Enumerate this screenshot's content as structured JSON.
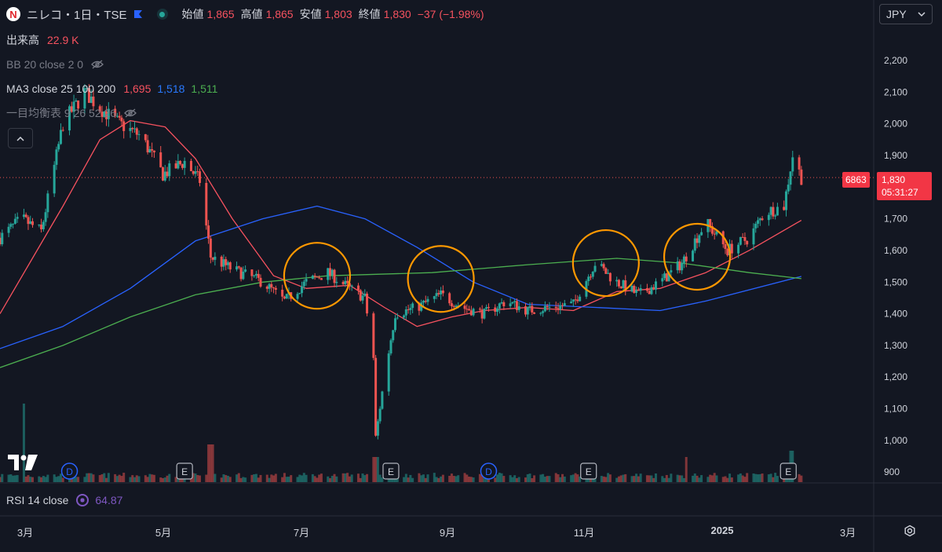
{
  "header": {
    "symbol_title": "ニレコ・1日・TSE",
    "logo_letter": "N",
    "open_label": "始値",
    "open": "1,865",
    "high_label": "高値",
    "high": "1,865",
    "low_label": "安値",
    "low": "1,803",
    "close_label": "終値",
    "close": "1,830",
    "change": "−37 (−1.98%)"
  },
  "legend": {
    "volume_label": "出来高",
    "volume_value": "22.9 K",
    "bb_label": "BB 20 close 2 0",
    "ma_label": "MA3 close 25 100 200",
    "ma25_value": "1,695",
    "ma100_value": "1,518",
    "ma200_value": "1,511",
    "ichimoku_label": "一目均衡表 9 26 52 26",
    "collapse_icon": "chevron-up-icon"
  },
  "currency": {
    "label": "JPY",
    "icon": "chevron-down-icon"
  },
  "price_labels": {
    "symbol_code": "6863",
    "last_price": "1,830",
    "countdown": "05:31:27"
  },
  "rsi": {
    "label": "RSI 14 close",
    "value": "64.87"
  },
  "colors": {
    "background": "#131722",
    "grid": "#1e222d",
    "up": "#26a69a",
    "down": "#ef5350",
    "ma25": "#f7525f",
    "ma100": "#2962ff",
    "ma200": "#4caf50",
    "highlight_circle": "#ff9800",
    "rsi": "#7e57c2"
  },
  "chart_data": {
    "type": "candlestick",
    "y_axis": {
      "ticks": [
        "900",
        "1,000",
        "1,100",
        "1,200",
        "1,300",
        "1,400",
        "1,500",
        "1,600",
        "1,700",
        "1,800",
        "1,900",
        "2,000",
        "2,100",
        "2,200"
      ],
      "ylim": [
        870,
        2260
      ]
    },
    "x_axis": {
      "labels": [
        "3月",
        "5月",
        "7月",
        "9月",
        "11月",
        "2025",
        "3月"
      ],
      "range": [
        "2024-02-15",
        "2025-03-15"
      ]
    },
    "price_series": [
      {
        "date": "2024-02-15",
        "close": 1640
      },
      {
        "date": "2024-02-25",
        "close": 1700
      },
      {
        "date": "2024-03-05",
        "close": 1660
      },
      {
        "date": "2024-03-15",
        "close": 2000
      },
      {
        "date": "2024-03-25",
        "close": 2100
      },
      {
        "date": "2024-04-01",
        "close": 2050
      },
      {
        "date": "2024-04-10",
        "close": 2000
      },
      {
        "date": "2024-04-20",
        "close": 1960
      },
      {
        "date": "2024-04-30",
        "close": 1840
      },
      {
        "date": "2024-05-10",
        "close": 1880
      },
      {
        "date": "2024-05-17",
        "close": 1820
      },
      {
        "date": "2024-05-22",
        "close": 1580
      },
      {
        "date": "2024-06-01",
        "close": 1540
      },
      {
        "date": "2024-06-15",
        "close": 1500
      },
      {
        "date": "2024-06-25",
        "close": 1440
      },
      {
        "date": "2024-07-05",
        "close": 1500
      },
      {
        "date": "2024-07-15",
        "close": 1530
      },
      {
        "date": "2024-07-25",
        "close": 1480
      },
      {
        "date": "2024-08-01",
        "close": 1450
      },
      {
        "date": "2024-08-05",
        "close": 1260
      },
      {
        "date": "2024-08-06",
        "close": 1010
      },
      {
        "date": "2024-08-10",
        "close": 1200
      },
      {
        "date": "2024-08-15",
        "close": 1400
      },
      {
        "date": "2024-08-25",
        "close": 1420
      },
      {
        "date": "2024-09-05",
        "close": 1460
      },
      {
        "date": "2024-09-15",
        "close": 1420
      },
      {
        "date": "2024-09-25",
        "close": 1400
      },
      {
        "date": "2024-10-05",
        "close": 1440
      },
      {
        "date": "2024-10-15",
        "close": 1410
      },
      {
        "date": "2024-10-25",
        "close": 1420
      },
      {
        "date": "2024-11-05",
        "close": 1430
      },
      {
        "date": "2024-11-15",
        "close": 1560
      },
      {
        "date": "2024-11-25",
        "close": 1500
      },
      {
        "date": "2024-12-05",
        "close": 1460
      },
      {
        "date": "2024-12-15",
        "close": 1500
      },
      {
        "date": "2024-12-25",
        "close": 1560
      },
      {
        "date": "2025-01-05",
        "close": 1690
      },
      {
        "date": "2025-01-15",
        "close": 1600
      },
      {
        "date": "2025-01-25",
        "close": 1640
      },
      {
        "date": "2025-02-01",
        "close": 1720
      },
      {
        "date": "2025-02-10",
        "close": 1740
      },
      {
        "date": "2025-02-14",
        "close": 1900
      },
      {
        "date": "2025-02-18",
        "close": 1830
      }
    ],
    "ma25": [
      {
        "date": "2024-02-15",
        "value": 1400
      },
      {
        "date": "2024-03-15",
        "value": 1740
      },
      {
        "date": "2024-04-01",
        "value": 1950
      },
      {
        "date": "2024-04-15",
        "value": 2010
      },
      {
        "date": "2024-05-01",
        "value": 1990
      },
      {
        "date": "2024-05-15",
        "value": 1890
      },
      {
        "date": "2024-06-01",
        "value": 1700
      },
      {
        "date": "2024-06-20",
        "value": 1520
      },
      {
        "date": "2024-07-05",
        "value": 1480
      },
      {
        "date": "2024-07-25",
        "value": 1490
      },
      {
        "date": "2024-08-10",
        "value": 1420
      },
      {
        "date": "2024-08-25",
        "value": 1360
      },
      {
        "date": "2024-09-10",
        "value": 1390
      },
      {
        "date": "2024-09-25",
        "value": 1410
      },
      {
        "date": "2024-10-15",
        "value": 1420
      },
      {
        "date": "2024-11-05",
        "value": 1410
      },
      {
        "date": "2024-11-25",
        "value": 1470
      },
      {
        "date": "2024-12-15",
        "value": 1480
      },
      {
        "date": "2025-01-05",
        "value": 1530
      },
      {
        "date": "2025-01-25",
        "value": 1600
      },
      {
        "date": "2025-02-18",
        "value": 1695
      }
    ],
    "ma100": [
      {
        "date": "2024-02-15",
        "value": 1290
      },
      {
        "date": "2024-03-15",
        "value": 1360
      },
      {
        "date": "2024-04-15",
        "value": 1480
      },
      {
        "date": "2024-05-15",
        "value": 1630
      },
      {
        "date": "2024-06-15",
        "value": 1700
      },
      {
        "date": "2024-07-10",
        "value": 1740
      },
      {
        "date": "2024-08-01",
        "value": 1700
      },
      {
        "date": "2024-08-25",
        "value": 1610
      },
      {
        "date": "2024-09-20",
        "value": 1500
      },
      {
        "date": "2024-10-15",
        "value": 1430
      },
      {
        "date": "2024-11-15",
        "value": 1420
      },
      {
        "date": "2024-12-15",
        "value": 1410
      },
      {
        "date": "2025-01-05",
        "value": 1440
      },
      {
        "date": "2025-02-18",
        "value": 1518
      }
    ],
    "ma200": [
      {
        "date": "2024-02-15",
        "value": 1230
      },
      {
        "date": "2024-03-15",
        "value": 1300
      },
      {
        "date": "2024-04-15",
        "value": 1390
      },
      {
        "date": "2024-05-15",
        "value": 1460
      },
      {
        "date": "2024-06-15",
        "value": 1500
      },
      {
        "date": "2024-07-15",
        "value": 1520
      },
      {
        "date": "2024-09-01",
        "value": 1530
      },
      {
        "date": "2024-10-15",
        "value": 1555
      },
      {
        "date": "2024-11-25",
        "value": 1575
      },
      {
        "date": "2024-12-25",
        "value": 1560
      },
      {
        "date": "2025-01-25",
        "value": 1530
      },
      {
        "date": "2025-02-18",
        "value": 1511
      }
    ],
    "highlight_circles": [
      {
        "date": "2024-07-10",
        "price": 1520
      },
      {
        "date": "2024-09-05",
        "price": 1510
      },
      {
        "date": "2024-11-20",
        "price": 1560
      },
      {
        "date": "2025-01-01",
        "price": 1580
      }
    ],
    "events": [
      {
        "date": "2024-03-18",
        "label": "D",
        "kind": "dividend"
      },
      {
        "date": "2024-05-10",
        "label": "E",
        "kind": "earnings"
      },
      {
        "date": "2024-08-13",
        "label": "E",
        "kind": "earnings"
      },
      {
        "date": "2024-09-27",
        "label": "D",
        "kind": "dividend"
      },
      {
        "date": "2024-11-12",
        "label": "E",
        "kind": "earnings"
      },
      {
        "date": "2025-02-12",
        "label": "E",
        "kind": "earnings"
      }
    ],
    "volume_spikes": [
      {
        "date": "2024-02-25",
        "value": 5.0
      },
      {
        "date": "2024-05-22",
        "value": 2.4
      },
      {
        "date": "2024-08-06",
        "value": 1.6
      },
      {
        "date": "2024-12-28",
        "value": 1.6
      },
      {
        "date": "2025-02-14",
        "value": 2.0
      }
    ]
  }
}
